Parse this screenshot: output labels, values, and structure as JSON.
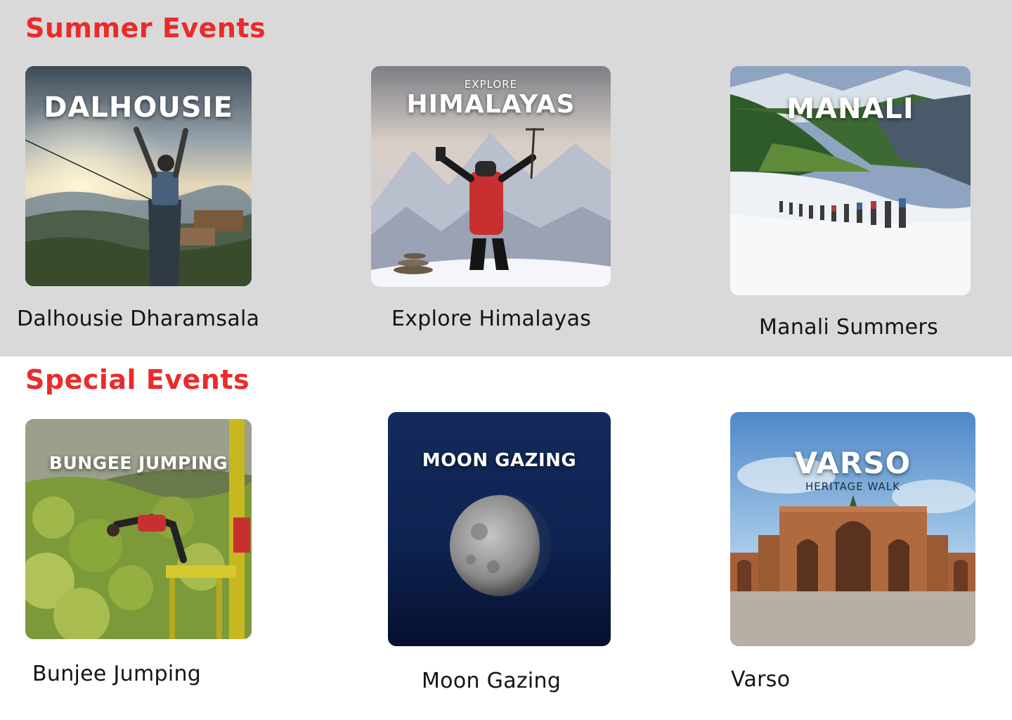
{
  "summer": {
    "title": "Summer Events",
    "events": [
      {
        "image_title": "DALHOUSIE",
        "caption": "Dalhousie Dharamsala"
      },
      {
        "image_kicker": "EXPLORE",
        "image_title": "HIMALAYAS",
        "caption": "Explore Himalayas"
      },
      {
        "image_title": "MANALI",
        "caption": "Manali Summers"
      }
    ]
  },
  "special": {
    "title": "Special Events",
    "events": [
      {
        "image_title": "BUNGEE JUMPING",
        "caption": "Bunjee Jumping"
      },
      {
        "image_title": "MOON GAZING",
        "caption": "Moon Gazing"
      },
      {
        "image_title": "VARSO",
        "image_subtitle": "HERITAGE WALK",
        "caption": "Varso"
      }
    ]
  },
  "colors": {
    "section_title": "#ea2b2b",
    "summer_background": "#d9d9d9",
    "special_background": "#ffffff",
    "caption_text": "#141414"
  }
}
